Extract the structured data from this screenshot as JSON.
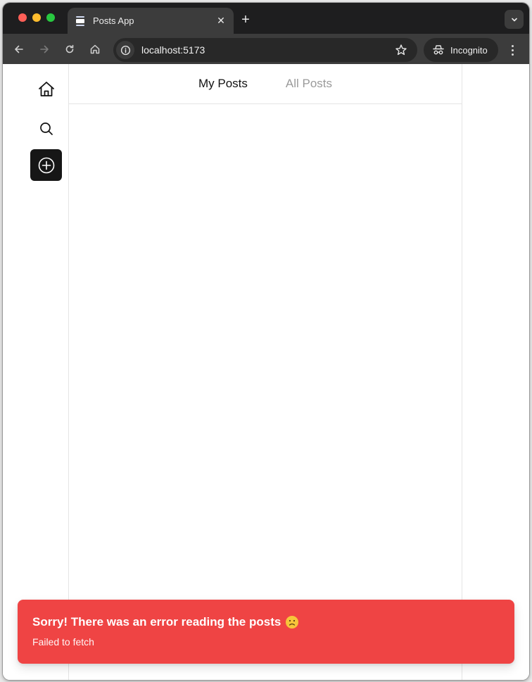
{
  "browser": {
    "tab": {
      "title": "Posts App",
      "favicon": "document-icon"
    },
    "new_tab_symbol": "+",
    "close_symbol": "✕",
    "address": {
      "url": "localhost:5173"
    },
    "profile": {
      "label": "Incognito",
      "icon": "incognito-icon"
    },
    "nav_icons": [
      "back-arrow-icon",
      "forward-arrow-icon",
      "reload-icon",
      "home-icon"
    ]
  },
  "sidebar": {
    "items": [
      {
        "name": "home",
        "icon": "home-icon"
      },
      {
        "name": "search",
        "icon": "search-icon"
      },
      {
        "name": "create",
        "icon": "plus-circle-icon",
        "active": true
      }
    ]
  },
  "main": {
    "tabs": [
      {
        "label": "My Posts",
        "active": true
      },
      {
        "label": "All Posts",
        "active": false
      }
    ]
  },
  "toast": {
    "title": "Sorry! There was an error reading the posts",
    "emoji": "slightly-frowning-face",
    "description": "Failed to fetch",
    "color": "#ef4444"
  },
  "colors": {
    "accent_dark": "#161616",
    "error": "#ef4444"
  }
}
